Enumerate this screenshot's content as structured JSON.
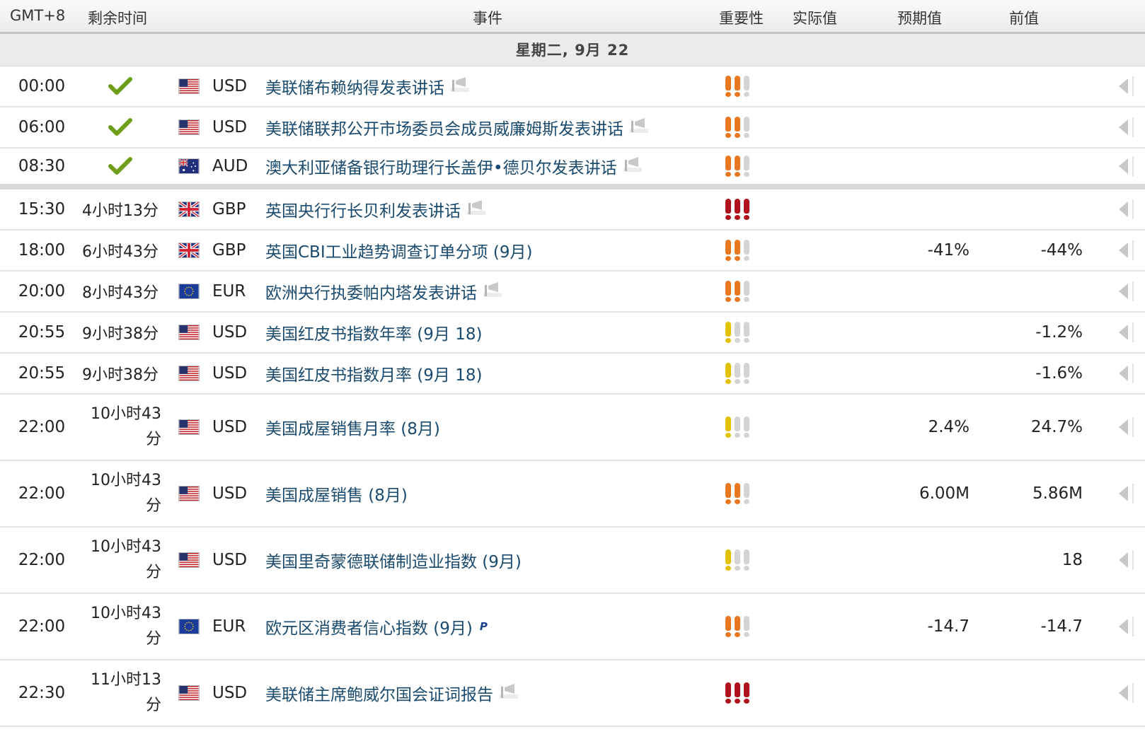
{
  "header": {
    "timezone": "GMT+8",
    "time_left": "剩余时间",
    "event": "事件",
    "importance": "重要性",
    "actual": "实际值",
    "forecast": "预期值",
    "previous": "前值"
  },
  "date_label": "星期二, 9月 22",
  "colors": {
    "orange": "#e87722",
    "red": "#b0121c",
    "yellow": "#e2c200",
    "grey": "#d4d4d4",
    "link": "#1a4a6e",
    "check": "#6f9e1b"
  },
  "events": [
    {
      "time": "00:00",
      "remaining": "",
      "done": true,
      "flag": "us",
      "currency": "USD",
      "name": "美联储布赖纳得发表讲话",
      "speech": true,
      "importance": 2,
      "actual": "",
      "forecast": "",
      "previous": ""
    },
    {
      "time": "06:00",
      "remaining": "",
      "done": true,
      "flag": "us",
      "currency": "USD",
      "name": "美联储联邦公开市场委员会成员威廉姆斯发表讲话",
      "speech": true,
      "importance": 2,
      "actual": "",
      "forecast": "",
      "previous": ""
    },
    {
      "time": "08:30",
      "remaining": "",
      "done": true,
      "flag": "au",
      "currency": "AUD",
      "name": "澳大利亚储备银行助理行长盖伊•德贝尔发表讲话",
      "speech": true,
      "importance": 2,
      "actual": "",
      "forecast": "",
      "previous": ""
    },
    {
      "time": "15:30",
      "remaining": "4小时13分",
      "done": false,
      "flag": "gb",
      "currency": "GBP",
      "name": "英国央行行长贝利发表讲话",
      "speech": true,
      "importance": 3,
      "actual": "",
      "forecast": "",
      "previous": ""
    },
    {
      "time": "18:00",
      "remaining": "6小时43分",
      "done": false,
      "flag": "gb",
      "currency": "GBP",
      "name": "英国CBI工业趋势调查订单分项 (9月)",
      "speech": false,
      "importance": 2,
      "actual": "",
      "forecast": "-41%",
      "previous": "-44%"
    },
    {
      "time": "20:00",
      "remaining": "8小时43分",
      "done": false,
      "flag": "eu",
      "currency": "EUR",
      "name": "欧洲央行执委帕内塔发表讲话",
      "speech": true,
      "importance": 2,
      "actual": "",
      "forecast": "",
      "previous": ""
    },
    {
      "time": "20:55",
      "remaining": "9小时38分",
      "done": false,
      "flag": "us",
      "currency": "USD",
      "name": "美国红皮书指数年率 (9月 18)",
      "speech": false,
      "importance": 1,
      "actual": "",
      "forecast": "",
      "previous": "-1.2%"
    },
    {
      "time": "20:55",
      "remaining": "9小时38分",
      "done": false,
      "flag": "us",
      "currency": "USD",
      "name": "美国红皮书指数月率 (9月 18)",
      "speech": false,
      "importance": 1,
      "actual": "",
      "forecast": "",
      "previous": "-1.6%"
    },
    {
      "time": "22:00",
      "remaining": "10小时43分",
      "remaining_l1": "10小时43",
      "remaining_l2": "分",
      "done": false,
      "flag": "us",
      "currency": "USD",
      "name": "美国成屋销售月率 (8月)",
      "speech": false,
      "importance": 1,
      "actual": "",
      "forecast": "2.4%",
      "previous": "24.7%"
    },
    {
      "time": "22:00",
      "remaining": "10小时43分",
      "remaining_l1": "10小时43",
      "remaining_l2": "分",
      "done": false,
      "flag": "us",
      "currency": "USD",
      "name": "美国成屋销售 (8月)",
      "speech": false,
      "importance": 2,
      "actual": "",
      "forecast": "6.00M",
      "previous": "5.86M"
    },
    {
      "time": "22:00",
      "remaining": "10小时43分",
      "remaining_l1": "10小时43",
      "remaining_l2": "分",
      "done": false,
      "flag": "us",
      "currency": "USD",
      "name": "美国里奇蒙德联储制造业指数 (9月)",
      "speech": false,
      "importance": 1,
      "actual": "",
      "forecast": "",
      "previous": "18"
    },
    {
      "time": "22:00",
      "remaining": "10小时43分",
      "remaining_l1": "10小时43",
      "remaining_l2": "分",
      "done": false,
      "flag": "eu",
      "currency": "EUR",
      "name": "欧元区消费者信心指数 (9月)",
      "speech": false,
      "preliminary": "P",
      "importance": 2,
      "actual": "",
      "forecast": "-14.7",
      "previous": "-14.7"
    },
    {
      "time": "22:30",
      "remaining": "11小时13分",
      "remaining_l1": "11小时13",
      "remaining_l2": "分",
      "done": false,
      "flag": "us",
      "currency": "USD",
      "name": "美联储主席鲍威尔国会证词报告",
      "speech": true,
      "importance": 3,
      "actual": "",
      "forecast": "",
      "previous": ""
    }
  ]
}
